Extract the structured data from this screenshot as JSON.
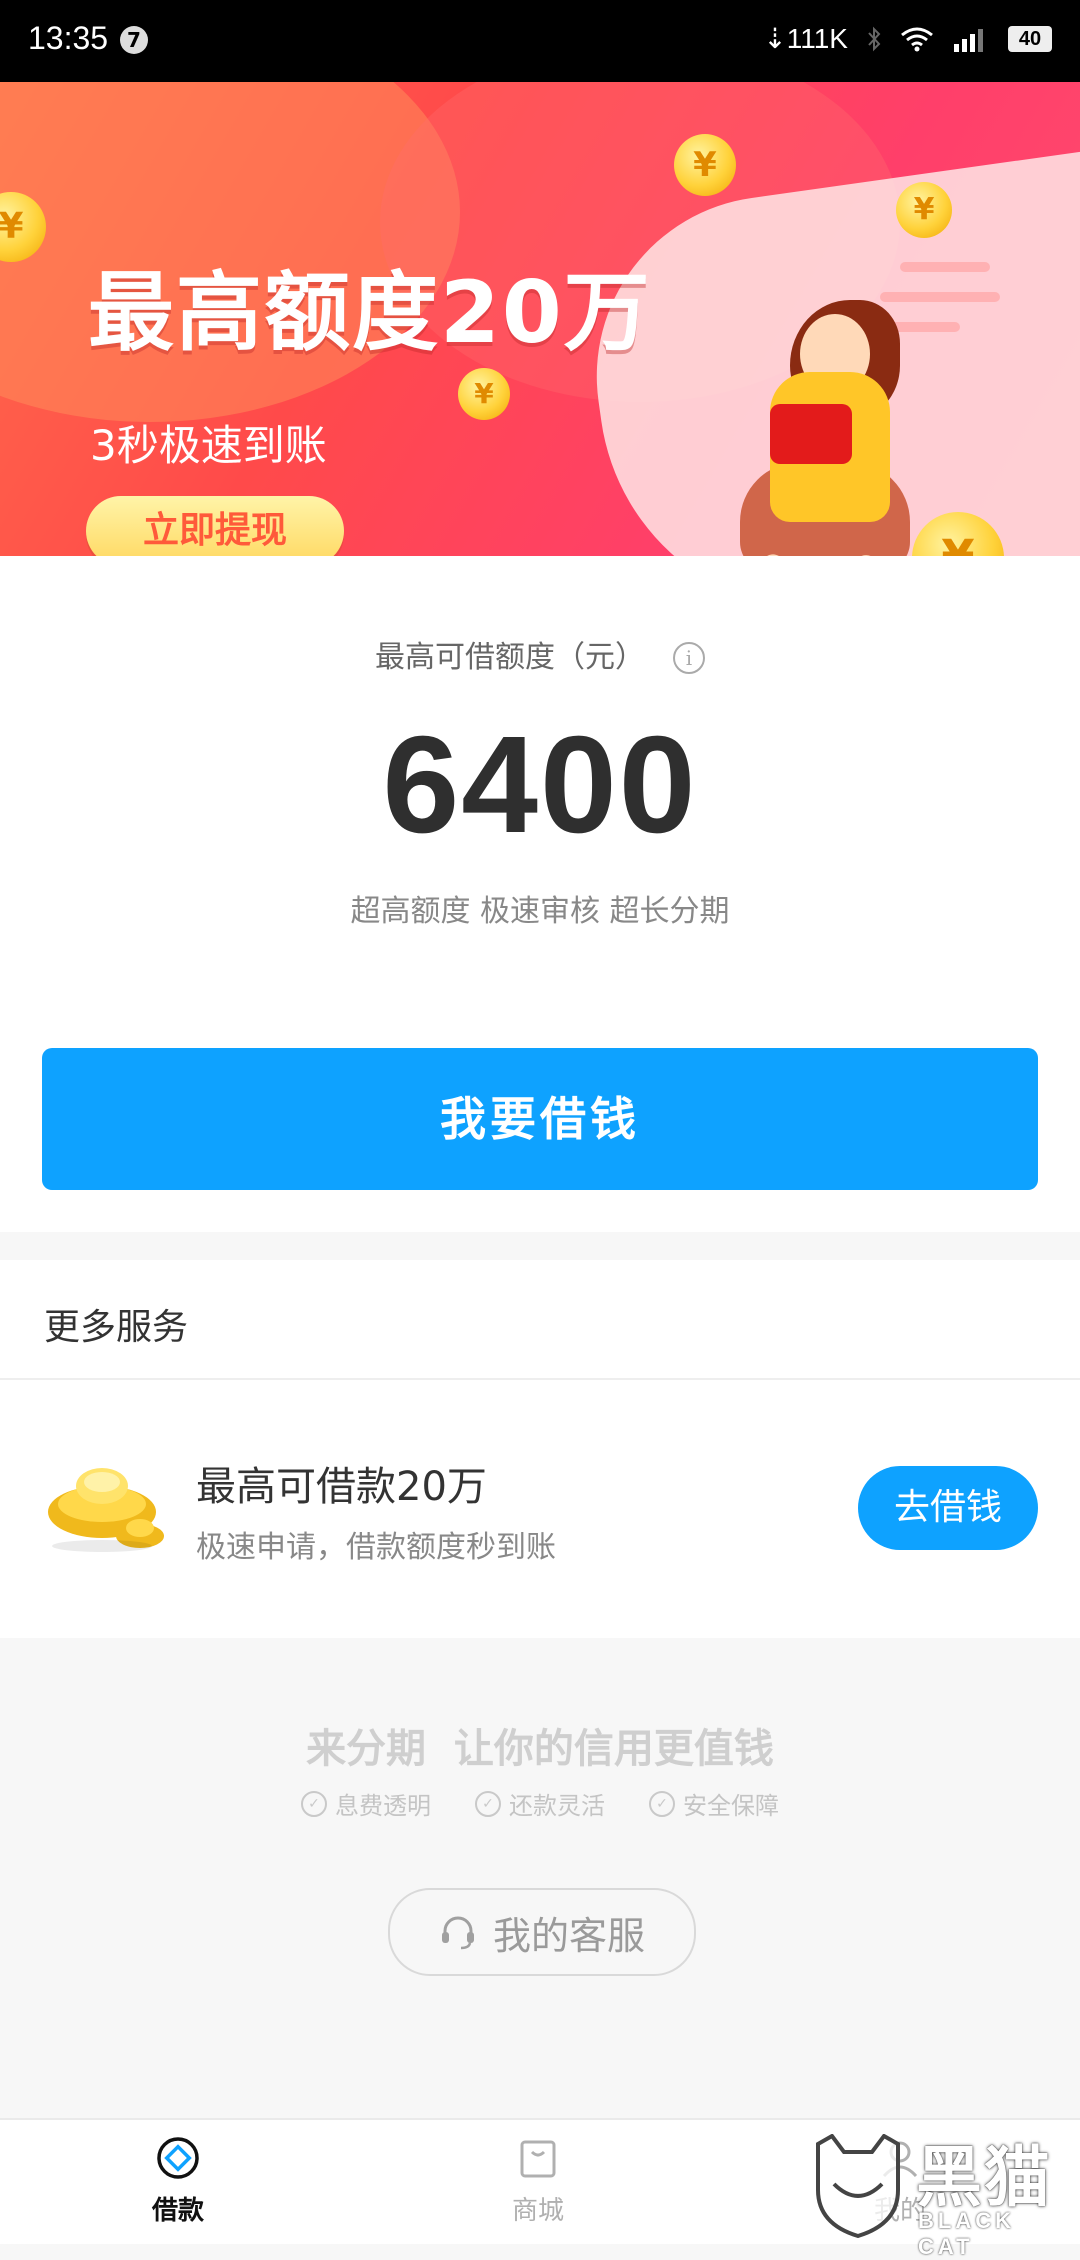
{
  "status_bar": {
    "time": "13:35",
    "notification_count": "7",
    "network_speed": "111K",
    "battery": "40"
  },
  "banner": {
    "title": "最高额度20万",
    "subtitle": "3秒极速到账",
    "button_label": "立即提现",
    "coin_symbol": "¥",
    "page_count": 2,
    "active_page": 1
  },
  "credit": {
    "label": "最高可借额度（元）",
    "info_icon": "i",
    "amount": "6400",
    "tags": "超高额度 极速审核 超长分期",
    "borrow_button": "我要借钱"
  },
  "services": {
    "title": "更多服务",
    "item": {
      "icon": "gold-ingot-icon",
      "title": "最高可借款20万",
      "subtitle": "极速申请，借款额度秒到账",
      "button": "去借钱"
    }
  },
  "promo": {
    "slogan": "来分期  让你的信用更值钱",
    "features": [
      "息费透明",
      "还款灵活",
      "安全保障"
    ],
    "customer_service": "我的客服"
  },
  "bottom_nav": {
    "items": [
      {
        "label": "借款",
        "icon": "borrow-icon",
        "active": true
      },
      {
        "label": "商城",
        "icon": "mall-bag-icon",
        "active": false
      },
      {
        "label": "我的",
        "icon": "profile-icon",
        "active": false
      }
    ]
  },
  "watermark": {
    "cn": "黑猫",
    "en": "BLACK CAT"
  },
  "colors": {
    "accent_blue": "#0ea2ff",
    "banner_red": "#ff4a4a"
  }
}
